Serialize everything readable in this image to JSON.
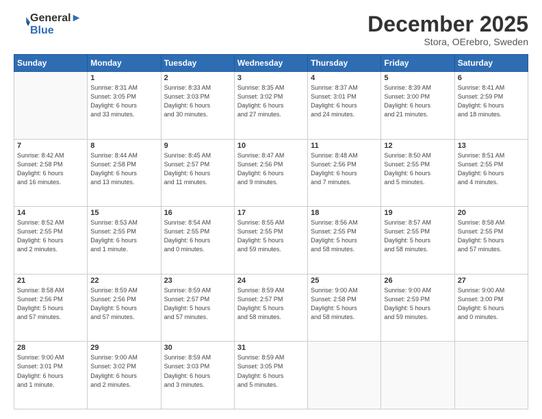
{
  "header": {
    "logo_line1": "General",
    "logo_line2": "Blue",
    "month": "December 2025",
    "location": "Stora, OErebro, Sweden"
  },
  "weekdays": [
    "Sunday",
    "Monday",
    "Tuesday",
    "Wednesday",
    "Thursday",
    "Friday",
    "Saturday"
  ],
  "weeks": [
    [
      {
        "day": "",
        "info": ""
      },
      {
        "day": "1",
        "info": "Sunrise: 8:31 AM\nSunset: 3:05 PM\nDaylight: 6 hours\nand 33 minutes."
      },
      {
        "day": "2",
        "info": "Sunrise: 8:33 AM\nSunset: 3:03 PM\nDaylight: 6 hours\nand 30 minutes."
      },
      {
        "day": "3",
        "info": "Sunrise: 8:35 AM\nSunset: 3:02 PM\nDaylight: 6 hours\nand 27 minutes."
      },
      {
        "day": "4",
        "info": "Sunrise: 8:37 AM\nSunset: 3:01 PM\nDaylight: 6 hours\nand 24 minutes."
      },
      {
        "day": "5",
        "info": "Sunrise: 8:39 AM\nSunset: 3:00 PM\nDaylight: 6 hours\nand 21 minutes."
      },
      {
        "day": "6",
        "info": "Sunrise: 8:41 AM\nSunset: 2:59 PM\nDaylight: 6 hours\nand 18 minutes."
      }
    ],
    [
      {
        "day": "7",
        "info": "Sunrise: 8:42 AM\nSunset: 2:58 PM\nDaylight: 6 hours\nand 16 minutes."
      },
      {
        "day": "8",
        "info": "Sunrise: 8:44 AM\nSunset: 2:58 PM\nDaylight: 6 hours\nand 13 minutes."
      },
      {
        "day": "9",
        "info": "Sunrise: 8:45 AM\nSunset: 2:57 PM\nDaylight: 6 hours\nand 11 minutes."
      },
      {
        "day": "10",
        "info": "Sunrise: 8:47 AM\nSunset: 2:56 PM\nDaylight: 6 hours\nand 9 minutes."
      },
      {
        "day": "11",
        "info": "Sunrise: 8:48 AM\nSunset: 2:56 PM\nDaylight: 6 hours\nand 7 minutes."
      },
      {
        "day": "12",
        "info": "Sunrise: 8:50 AM\nSunset: 2:55 PM\nDaylight: 6 hours\nand 5 minutes."
      },
      {
        "day": "13",
        "info": "Sunrise: 8:51 AM\nSunset: 2:55 PM\nDaylight: 6 hours\nand 4 minutes."
      }
    ],
    [
      {
        "day": "14",
        "info": "Sunrise: 8:52 AM\nSunset: 2:55 PM\nDaylight: 6 hours\nand 2 minutes."
      },
      {
        "day": "15",
        "info": "Sunrise: 8:53 AM\nSunset: 2:55 PM\nDaylight: 6 hours\nand 1 minute."
      },
      {
        "day": "16",
        "info": "Sunrise: 8:54 AM\nSunset: 2:55 PM\nDaylight: 6 hours\nand 0 minutes."
      },
      {
        "day": "17",
        "info": "Sunrise: 8:55 AM\nSunset: 2:55 PM\nDaylight: 5 hours\nand 59 minutes."
      },
      {
        "day": "18",
        "info": "Sunrise: 8:56 AM\nSunset: 2:55 PM\nDaylight: 5 hours\nand 58 minutes."
      },
      {
        "day": "19",
        "info": "Sunrise: 8:57 AM\nSunset: 2:55 PM\nDaylight: 5 hours\nand 58 minutes."
      },
      {
        "day": "20",
        "info": "Sunrise: 8:58 AM\nSunset: 2:55 PM\nDaylight: 5 hours\nand 57 minutes."
      }
    ],
    [
      {
        "day": "21",
        "info": "Sunrise: 8:58 AM\nSunset: 2:56 PM\nDaylight: 5 hours\nand 57 minutes."
      },
      {
        "day": "22",
        "info": "Sunrise: 8:59 AM\nSunset: 2:56 PM\nDaylight: 5 hours\nand 57 minutes."
      },
      {
        "day": "23",
        "info": "Sunrise: 8:59 AM\nSunset: 2:57 PM\nDaylight: 5 hours\nand 57 minutes."
      },
      {
        "day": "24",
        "info": "Sunrise: 8:59 AM\nSunset: 2:57 PM\nDaylight: 5 hours\nand 58 minutes."
      },
      {
        "day": "25",
        "info": "Sunrise: 9:00 AM\nSunset: 2:58 PM\nDaylight: 5 hours\nand 58 minutes."
      },
      {
        "day": "26",
        "info": "Sunrise: 9:00 AM\nSunset: 2:59 PM\nDaylight: 5 hours\nand 59 minutes."
      },
      {
        "day": "27",
        "info": "Sunrise: 9:00 AM\nSunset: 3:00 PM\nDaylight: 6 hours\nand 0 minutes."
      }
    ],
    [
      {
        "day": "28",
        "info": "Sunrise: 9:00 AM\nSunset: 3:01 PM\nDaylight: 6 hours\nand 1 minute."
      },
      {
        "day": "29",
        "info": "Sunrise: 9:00 AM\nSunset: 3:02 PM\nDaylight: 6 hours\nand 2 minutes."
      },
      {
        "day": "30",
        "info": "Sunrise: 8:59 AM\nSunset: 3:03 PM\nDaylight: 6 hours\nand 3 minutes."
      },
      {
        "day": "31",
        "info": "Sunrise: 8:59 AM\nSunset: 3:05 PM\nDaylight: 6 hours\nand 5 minutes."
      },
      {
        "day": "",
        "info": ""
      },
      {
        "day": "",
        "info": ""
      },
      {
        "day": "",
        "info": ""
      }
    ]
  ]
}
